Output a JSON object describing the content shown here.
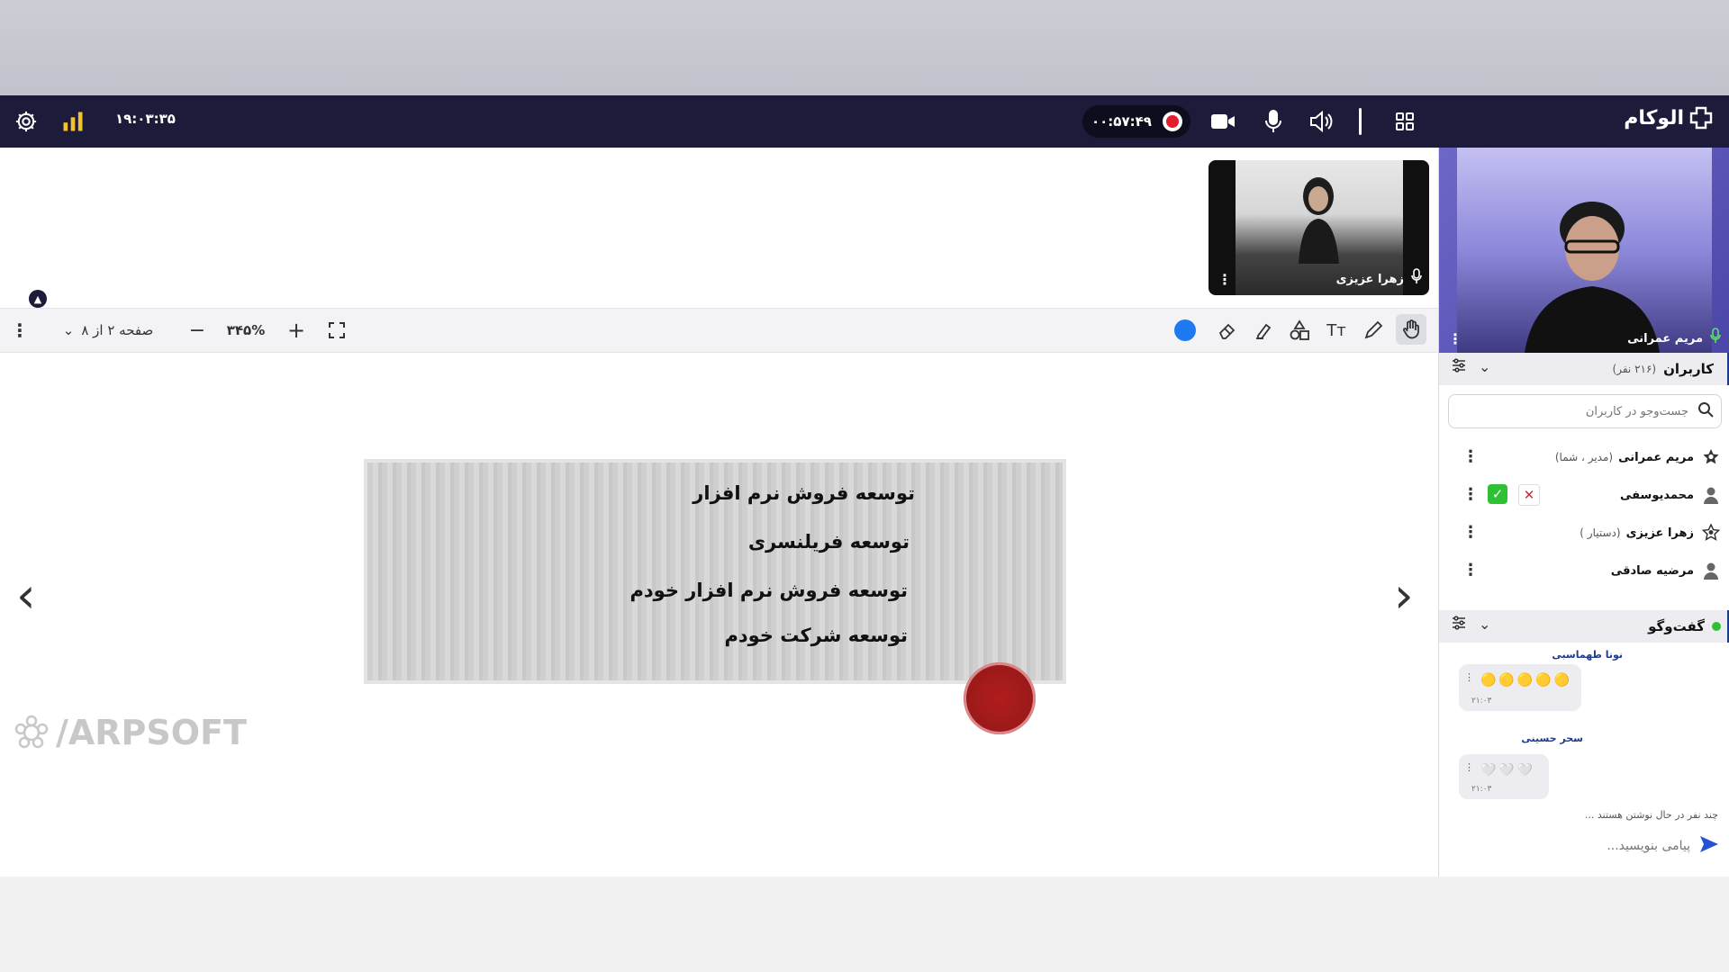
{
  "header": {
    "clock": "۱۹:۰۳:۳۵",
    "rec_time": "۰۰:۵۷:۴۹",
    "logo": "الوکام"
  },
  "presenter_thumb": {
    "name": "زهرا عزیزی"
  },
  "whiteboard": {
    "page_label": "صفحه ۲ از ۸",
    "zoom": "۳۴۵%"
  },
  "slide": {
    "lines": [
      "توسعه فروش نرم افزار",
      "توسعه فریلنسری",
      "توسعه فروش نرم افزار خودم",
      "توسعه شرکت خودم"
    ]
  },
  "watermark": "/ARPSOFT",
  "sidebar": {
    "self_cam_name": "مریم عمرانی",
    "users": {
      "title": "کاربران",
      "count": "(۲۱۶ نفر)",
      "search_placeholder": "جست‌وجو در کاربران",
      "list": [
        {
          "name": "مریم عمرانی",
          "role": "(مدیر ، شما)"
        },
        {
          "name": "محمدیوسفی",
          "role": ""
        },
        {
          "name": "زهرا عزیزی",
          "role": "(دستیار )"
        },
        {
          "name": "مرضیه صادقی",
          "role": ""
        }
      ]
    },
    "chat": {
      "title": "گفت‌وگو",
      "messages": [
        {
          "sender": "نونا طهماسبی",
          "emoji": "🟡🟡🟡🟡🟡",
          "time": "۲۱:۰۳"
        },
        {
          "sender": "سحر حسینی",
          "emoji": "🤍🤍🤍",
          "time": "۲۱:۰۳"
        }
      ],
      "typing": "چند نفر در حال نوشتن هستند ...",
      "compose_placeholder": "پیامی بنویسید..."
    }
  }
}
